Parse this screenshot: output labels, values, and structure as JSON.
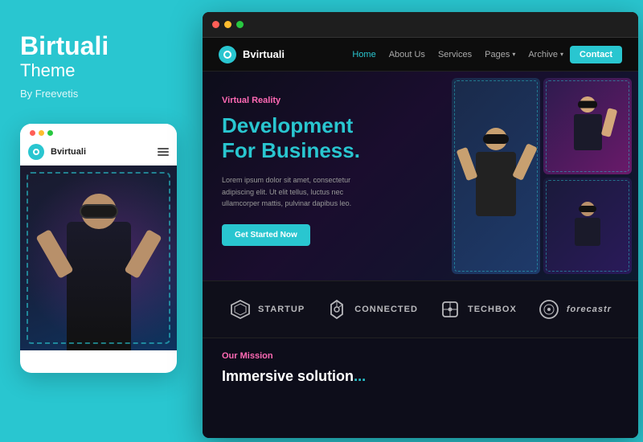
{
  "left_panel": {
    "title_bold": "Birtuali",
    "title_light": "Theme",
    "by": "By Freevetis"
  },
  "mobile_mockup": {
    "brand_name": "Bvirtuali",
    "dots": [
      "red",
      "yellow",
      "green"
    ]
  },
  "browser": {
    "dots": [
      "red",
      "yellow",
      "green"
    ],
    "nav": {
      "logo_text": "Bvirtuali",
      "links": [
        {
          "label": "Home",
          "active": true
        },
        {
          "label": "About Us",
          "active": false
        },
        {
          "label": "Services",
          "active": false
        },
        {
          "label": "Pages",
          "active": false,
          "dropdown": true
        },
        {
          "label": "Archive",
          "active": false,
          "dropdown": true
        }
      ],
      "contact_label": "Contact"
    },
    "hero": {
      "tag": "Virtual Reality",
      "title_line1": "Development",
      "title_line2": "For Business",
      "title_accent": ".",
      "description": "Lorem ipsum dolor sit amet, consectetur adipiscing elit. Ut elit tellus, luctus nec ullamcorper mattis, pulvinar dapibus leo.",
      "cta_label": "Get Started Now"
    },
    "brands": [
      {
        "name": "STARTUP",
        "icon": "hexagon-icon"
      },
      {
        "name": "CONNECTED",
        "icon": "shield-icon"
      },
      {
        "name": "TECHBOX",
        "icon": "cube-icon"
      },
      {
        "name": "forecastr",
        "icon": "circle-icon"
      }
    ],
    "mission": {
      "tag": "Our Mission",
      "title_line1": "Immersive solution...",
      "title_line2": ""
    }
  }
}
